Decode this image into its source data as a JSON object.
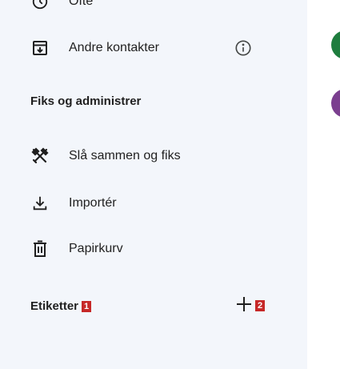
{
  "sidebar": {
    "items": [
      {
        "label": "Ofte",
        "icon": "history-icon"
      },
      {
        "label": "Andre kontakter",
        "icon": "archive-download-icon",
        "info_icon": "info-icon"
      }
    ],
    "fix_section": {
      "title": "Fiks og administrer",
      "items": [
        {
          "label": "Slå sammen og fiks",
          "icon": "tools-icon"
        },
        {
          "label": "Importér",
          "icon": "download-icon"
        },
        {
          "label": "Papirkurv",
          "icon": "trash-icon"
        }
      ]
    },
    "labels_section": {
      "title": "Etiketter",
      "badge": "1",
      "add_icon": "plus-icon",
      "add_badge": "2"
    }
  },
  "colors": {
    "sidebar_bg": "#f3f6fb",
    "badge": "#c62828",
    "avatar_green": "#1e7d3e",
    "avatar_purple": "#7b3f8f"
  }
}
